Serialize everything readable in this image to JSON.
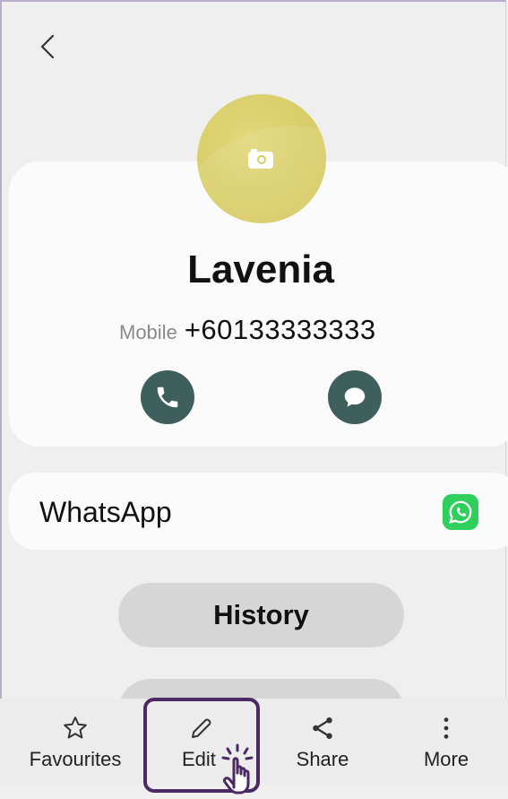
{
  "contact": {
    "name": "Lavenia",
    "phone_label": "Mobile",
    "phone_number": "+60133333333"
  },
  "apps": {
    "whatsapp_label": "WhatsApp"
  },
  "history_button": "History",
  "bottom_bar": {
    "favourites": "Favourites",
    "edit": "Edit",
    "share": "Share",
    "more": "More"
  },
  "icons": {
    "back": "chevron-left-icon",
    "camera": "camera-icon",
    "call": "phone-icon",
    "message": "chat-bubble-icon",
    "whatsapp": "whatsapp-icon",
    "favourites": "star-icon",
    "edit": "pencil-icon",
    "share": "share-icon",
    "more": "more-vertical-icon",
    "cursor": "hand-pointer-icon"
  },
  "colors": {
    "avatar": "#d8cd67",
    "action_buttons": "#3f5f5c",
    "whatsapp": "#2fcf5e",
    "highlight": "#4b2a63"
  }
}
